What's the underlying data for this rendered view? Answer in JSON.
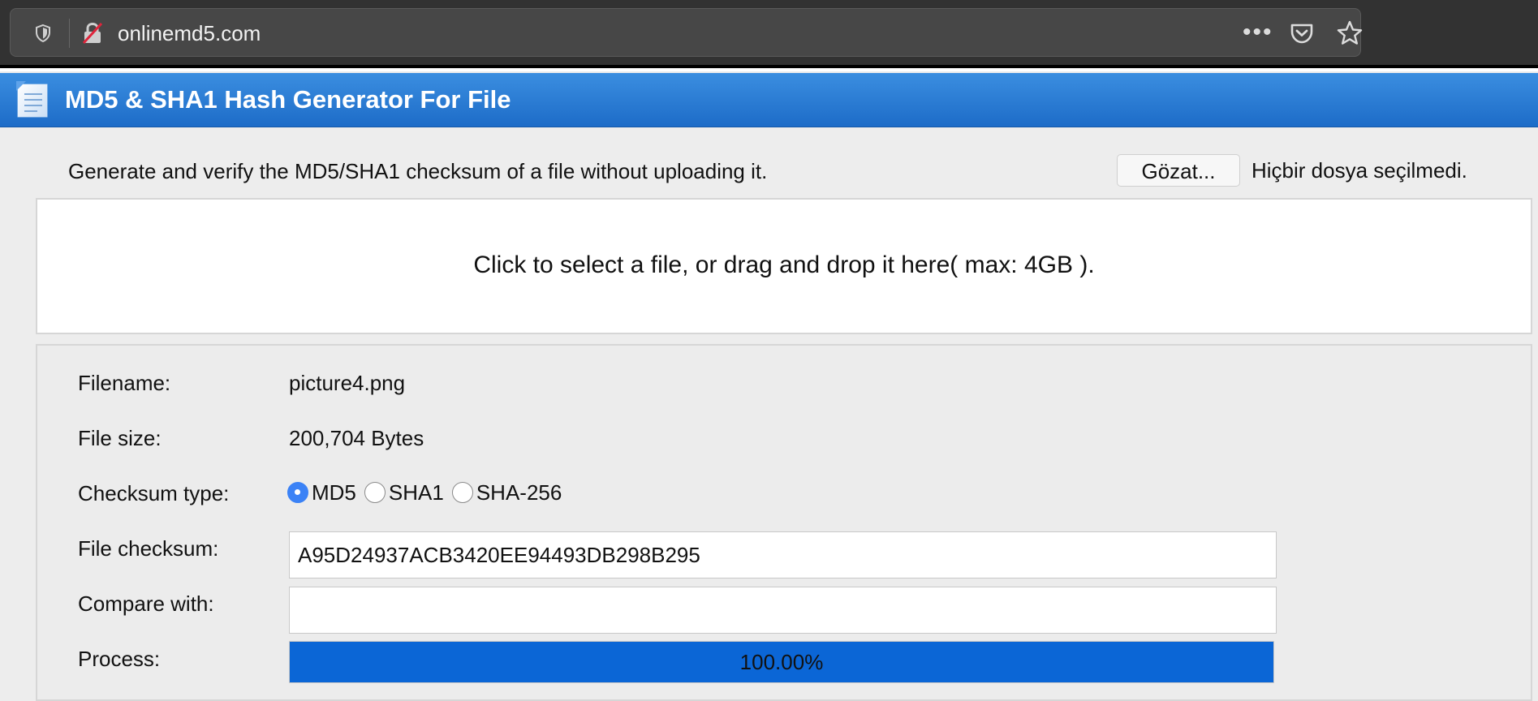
{
  "browser": {
    "url": "onlinemd5.com",
    "more_icon": "more-icon",
    "pocket_icon": "pocket-icon",
    "star_icon": "bookmark-star-icon"
  },
  "header": {
    "title": "MD5 & SHA1 Hash Generator For File",
    "color": "#2a7dd8"
  },
  "intro": {
    "text": "Generate and verify the MD5/SHA1 checksum of a file without uploading it."
  },
  "file_input": {
    "button_label": "Gözat...",
    "status_text": "Hiçbir dosya seçilmedi."
  },
  "drop_zone": {
    "text": "Click to select a file, or drag and drop it here( max: 4GB )."
  },
  "details": {
    "filename_label": "Filename:",
    "filename_value": "picture4.png",
    "filesize_label": "File size:",
    "filesize_value": "200,704 Bytes",
    "checksum_type_label": "Checksum type:",
    "checksum_types": [
      "MD5",
      "SHA1",
      "SHA-256"
    ],
    "checksum_type_selected": "MD5",
    "file_checksum_label": "File checksum:",
    "file_checksum_value": "A95D24937ACB3420EE94493DB298B295",
    "compare_label": "Compare with:",
    "compare_value": "",
    "process_label": "Process:",
    "process_text": "100.00%",
    "process_fraction": 1.0,
    "progress_color": "#0b66d6"
  }
}
